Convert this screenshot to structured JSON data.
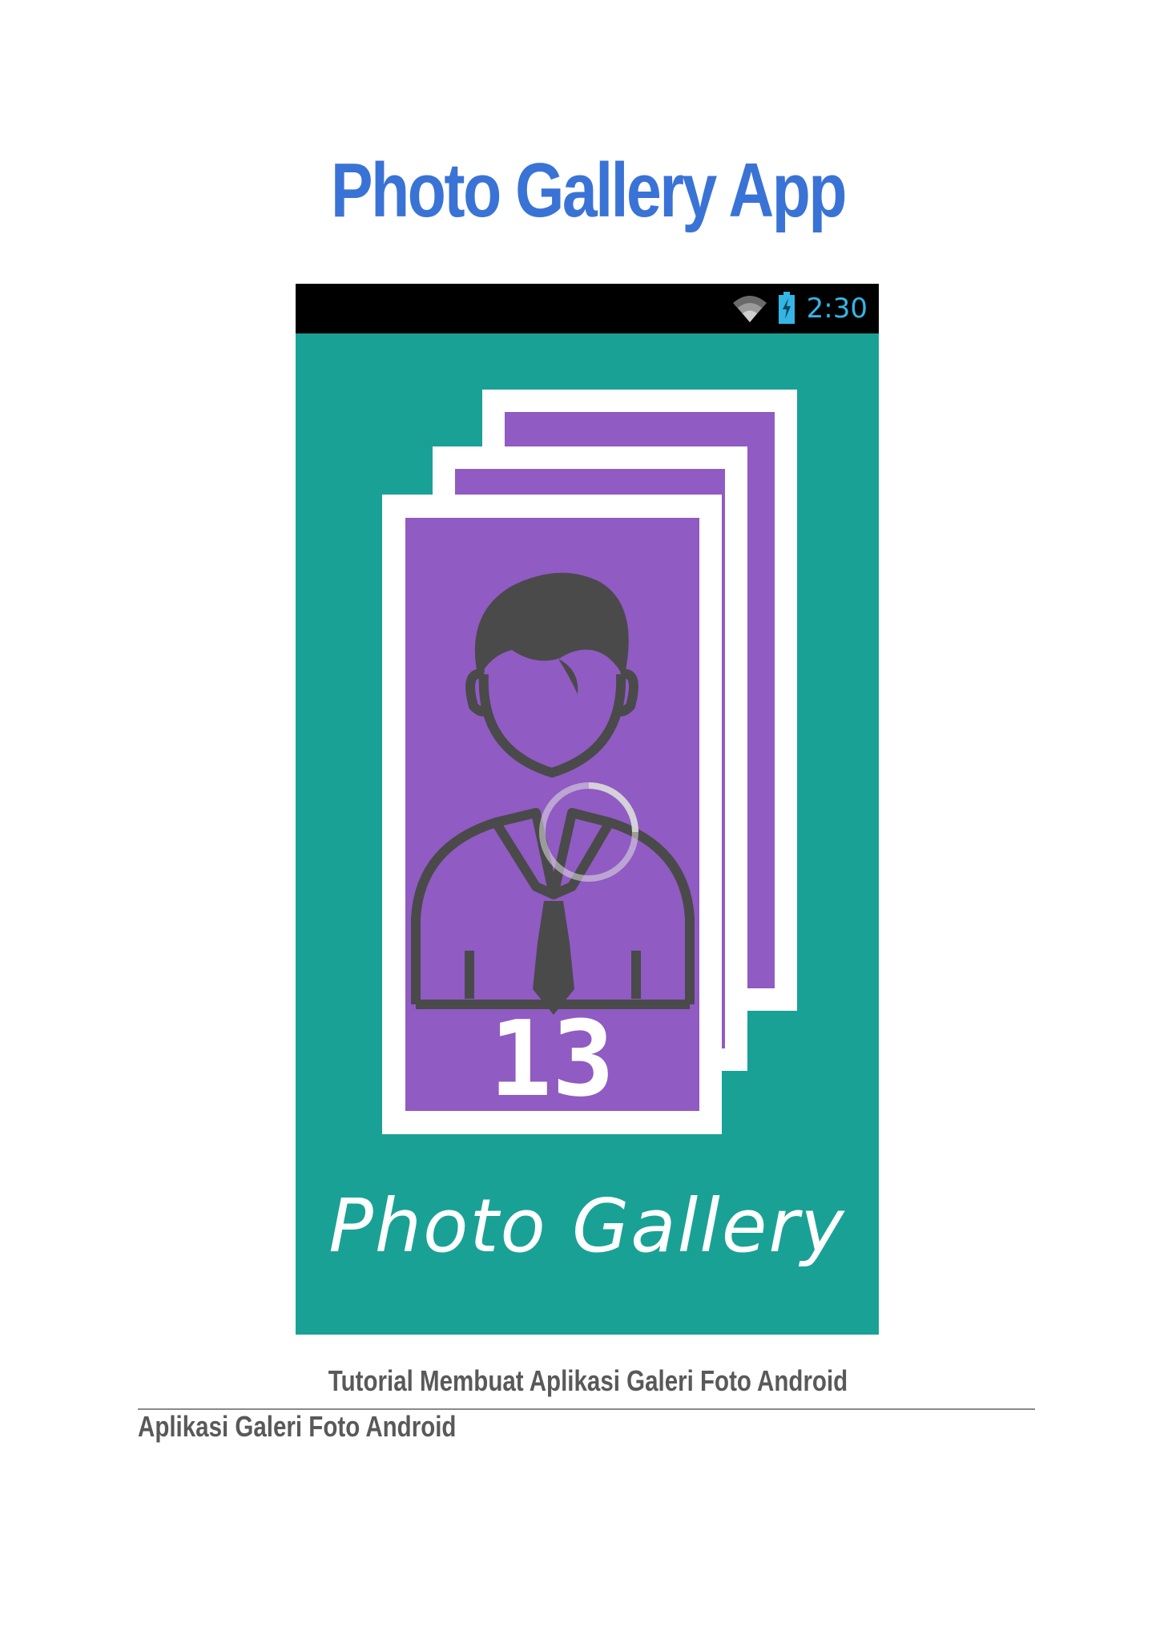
{
  "document": {
    "title": "Photo Gallery App",
    "caption": "Tutorial Membuat Aplikasi Galeri Foto Android",
    "section_heading": "Aplikasi Galeri Foto Android"
  },
  "screenshot": {
    "status_bar": {
      "time": "2:30",
      "icons": [
        "wifi-icon",
        "battery-charging-icon"
      ]
    },
    "splash": {
      "badge_number": "13",
      "app_name": "Photo Gallery",
      "loading_indicator": "spinner"
    },
    "colors": {
      "background": "#1aa196",
      "card_frame": "#ffffff",
      "card_fill": "#905bc3",
      "figure": "#4a4a4a",
      "status_bar": "#000000",
      "clock": "#33b5e5"
    }
  }
}
